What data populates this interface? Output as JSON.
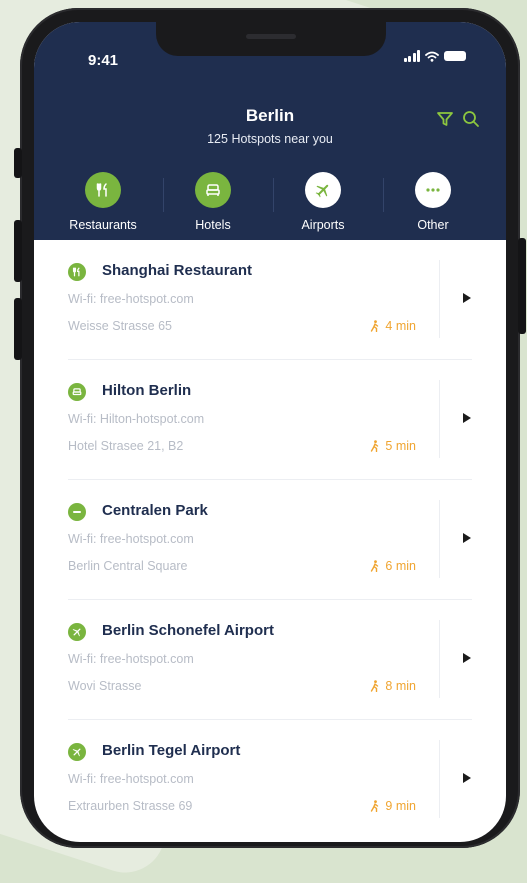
{
  "status_bar": {
    "time": "9:41"
  },
  "header": {
    "city": "Berlin",
    "subtitle": "125 Hotspots near you",
    "filter_icon": "filter-icon",
    "search_icon": "search-icon"
  },
  "categories": [
    {
      "label": "Restaurants",
      "icon": "fork-knife-icon",
      "active": true
    },
    {
      "label": "Hotels",
      "icon": "bed-icon",
      "active": true
    },
    {
      "label": "Airports",
      "icon": "plane-icon",
      "active": false
    },
    {
      "label": "Other",
      "icon": "more-dots-icon",
      "active": false
    }
  ],
  "hotspots": [
    {
      "name": "Shanghai Restaurant",
      "wifi": "Wi-fi: free-hotspot.com",
      "address": "Weisse Strasse 65",
      "eta": "4 min",
      "icon": "fork-knife-icon"
    },
    {
      "name": "Hilton Berlin",
      "wifi": "Wi-fi: Hilton-hotspot.com",
      "address": "Hotel Strasee 21, B2",
      "eta": "5 min",
      "icon": "bed-icon"
    },
    {
      "name": "Centralen Park",
      "wifi": "Wi-fi: free-hotspot.com",
      "address": "Berlin Central Square",
      "eta": "6 min",
      "icon": "more-dots-icon"
    },
    {
      "name": "Berlin Schonefel Airport",
      "wifi": "Wi-fi: free-hotspot.com",
      "address": "Wovi Strasse",
      "eta": "8 min",
      "icon": "plane-icon"
    },
    {
      "name": "Berlin Tegel Airport",
      "wifi": "Wi-fi: free-hotspot.com",
      "address": "Extraurben Strasse 69",
      "eta": "9 min",
      "icon": "plane-icon"
    }
  ],
  "colors": {
    "header_bg": "#1f2e4f",
    "accent_green": "#7ab53f",
    "eta_orange": "#f0a531",
    "page_bg": "#d9e4cf"
  }
}
